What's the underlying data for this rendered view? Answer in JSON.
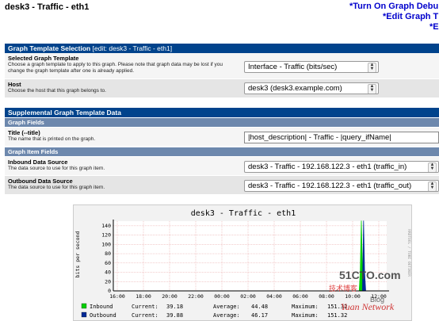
{
  "header": {
    "title": "desk3 - Traffic - eth1",
    "links": [
      "*Turn On Graph Debu",
      "*Edit Graph T",
      "*E"
    ]
  },
  "graph_template_selection": {
    "heading": "Graph Template Selection",
    "heading_sub": "[edit: desk3 - Traffic - eth1]",
    "selected_template": {
      "label": "Selected Graph Template",
      "desc": "Choose a graph template to apply to this graph. Please note that graph data may be lost if you change the graph template after one is already applied.",
      "value": "Interface - Traffic (bits/sec)"
    },
    "host": {
      "label": "Host",
      "desc": "Choose the host that this graph belongs to.",
      "value": "desk3 (desk3.example.com)"
    }
  },
  "supplemental": {
    "heading": "Supplemental Graph Template Data",
    "graph_fields_heading": "Graph Fields",
    "title_field": {
      "label": "Title (--title)",
      "desc": "The name that is printed on the graph.",
      "value": "|host_description| - Traffic - |query_ifName|"
    },
    "graph_item_fields_heading": "Graph Item Fields",
    "inbound": {
      "label": "Inbound Data Source",
      "desc": "The data source to use for this graph item.",
      "value": "desk3 - Traffic - 192.168.122.3 - eth1 (traffic_in)"
    },
    "outbound": {
      "label": "Outbound Data Source",
      "desc": "The data source to use for this graph item.",
      "value": "desk3 - Traffic - 192.168.122.3 - eth1 (traffic_out)"
    }
  },
  "graph": {
    "title": "desk3 - Traffic - eth1",
    "ylabel": "bits per second",
    "side_label": "RRDTOOL / TOBI OETIKER",
    "y_ticks": [
      "0",
      "20",
      "40",
      "60",
      "80",
      "100",
      "120",
      "140"
    ],
    "x_ticks": [
      "16:00",
      "18:00",
      "20:00",
      "22:00",
      "00:00",
      "02:00",
      "04:00",
      "06:00",
      "08:00",
      "10:00",
      "12:00"
    ],
    "ylim": [
      0,
      150
    ],
    "legend": [
      {
        "name": "Inbound",
        "color": "#00cf00",
        "current_label": "Current:",
        "current": "39.18",
        "average_label": "Average:",
        "average": "44.48",
        "maximum_label": "Maximum:",
        "maximum": "151.32"
      },
      {
        "name": "Outbound",
        "color": "#002a97",
        "current_label": "Current:",
        "current": "39.88",
        "average_label": "Average:",
        "average": "46.17",
        "maximum_label": "Maximum:",
        "maximum": "151.32"
      }
    ],
    "watermark": {
      "site": "51CTO.com",
      "cn": "技术博客",
      "blog": "Blog",
      "net": "Yuan Network"
    }
  },
  "chart_data": {
    "type": "area",
    "title": "desk3 - Traffic - eth1",
    "ylabel": "bits per second",
    "x_ticks": [
      "16:00",
      "18:00",
      "20:00",
      "22:00",
      "00:00",
      "02:00",
      "04:00",
      "06:00",
      "08:00",
      "10:00",
      "12:00"
    ],
    "ylim": [
      0,
      150
    ],
    "series": [
      {
        "name": "Inbound",
        "color": "#00cf00",
        "x": [
          "10:30",
          "10:35",
          "10:40",
          "10:45",
          "10:50"
        ],
        "values": [
          0,
          40,
          151,
          40,
          0
        ]
      },
      {
        "name": "Outbound",
        "color": "#002a97",
        "x": [
          "10:45",
          "10:50",
          "10:55",
          "11:00"
        ],
        "values": [
          0,
          151,
          40,
          0
        ]
      }
    ]
  }
}
